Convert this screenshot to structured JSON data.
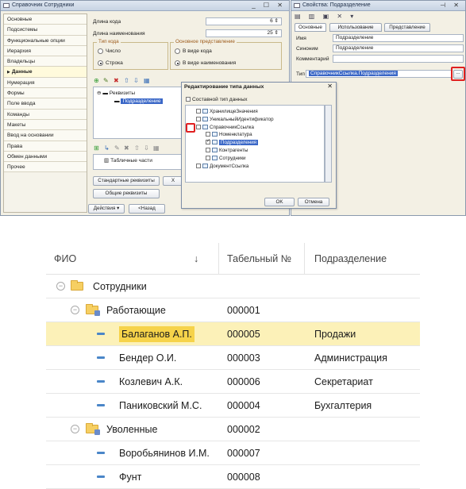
{
  "left_window": {
    "title": "Справочник Сотрудники",
    "nav": [
      "Основные",
      "Подсистемы",
      "Функциональные опции",
      "Иерархия",
      "Владельцы",
      "Данные",
      "Нумерация",
      "Формы",
      "Поле ввода",
      "Команды",
      "Макеты",
      "Ввод на основании",
      "Права",
      "Обмен данными",
      "Прочее"
    ],
    "code_length_label": "Длина кода",
    "code_length_value": "6",
    "name_length_label": "Длина наименования",
    "name_length_value": "25",
    "code_type_group": "Тип кода",
    "code_type_number": "Число",
    "code_type_string": "Строка",
    "main_repr_group": "Основное представление",
    "repr_code": "В виде кода",
    "repr_name": "В виде наименования",
    "tree_root": "Реквизиты",
    "tree_child": "Подразделение",
    "tab_parts": "Табличные части",
    "std_attrs_button": "Стандартные реквизиты",
    "common_attrs_button": "Общие реквизиты",
    "actions_button": "Действия",
    "back_button": "<Назад"
  },
  "right_window": {
    "title": "Свойства: Подразделение",
    "tabs": [
      "Основные",
      "Использование",
      "Представление"
    ],
    "name_label": "Имя",
    "name_value": "Подразделение",
    "synonym_label": "Синоним",
    "synonym_value": "Подразделение",
    "comment_label": "Комментарий",
    "type_label": "Тип",
    "type_value": "СправочникСсылка.Подразделения",
    "ellipsis": "..."
  },
  "dialog": {
    "title": "Редактирование типа данных",
    "composite_label": "Составной тип данных",
    "items": [
      {
        "label": "ХранилищеЗначения",
        "checked": false
      },
      {
        "label": "УникальныйИдентификатор",
        "checked": false
      },
      {
        "label": "СправочникСсылка",
        "checked": false
      },
      {
        "label": "Номенклатура",
        "checked": false
      },
      {
        "label": "Подразделения",
        "checked": true
      },
      {
        "label": "Контрагенты",
        "checked": false
      },
      {
        "label": "Сотрудники",
        "checked": false
      },
      {
        "label": "ДокументСсылка",
        "checked": false
      }
    ],
    "ok": "OK",
    "cancel": "Отмена"
  },
  "table": {
    "columns": [
      "ФИО",
      "Табельный №",
      "Подразделение"
    ],
    "sort_arrow": "↓",
    "rows": [
      {
        "kind": "group",
        "name": "Сотрудники",
        "tab": "",
        "dept": ""
      },
      {
        "kind": "subgroup",
        "name": "Работающие",
        "tab": "000001",
        "dept": ""
      },
      {
        "kind": "item",
        "name": "Балаганов А.П.",
        "tab": "000005",
        "dept": "Продажи",
        "selected": true
      },
      {
        "kind": "item",
        "name": "Бендер О.И.",
        "tab": "000003",
        "dept": "Администрация"
      },
      {
        "kind": "item",
        "name": "Козлевич А.К.",
        "tab": "000006",
        "dept": "Секретариат"
      },
      {
        "kind": "item",
        "name": "Паниковский М.С.",
        "tab": "000004",
        "dept": "Бухгалтерия"
      },
      {
        "kind": "subgroup",
        "name": "Уволенные",
        "tab": "000002",
        "dept": ""
      },
      {
        "kind": "item",
        "name": "Воробьянинов И.М.",
        "tab": "000007",
        "dept": ""
      },
      {
        "kind": "item",
        "name": "Фунт",
        "tab": "000008",
        "dept": ""
      }
    ]
  }
}
